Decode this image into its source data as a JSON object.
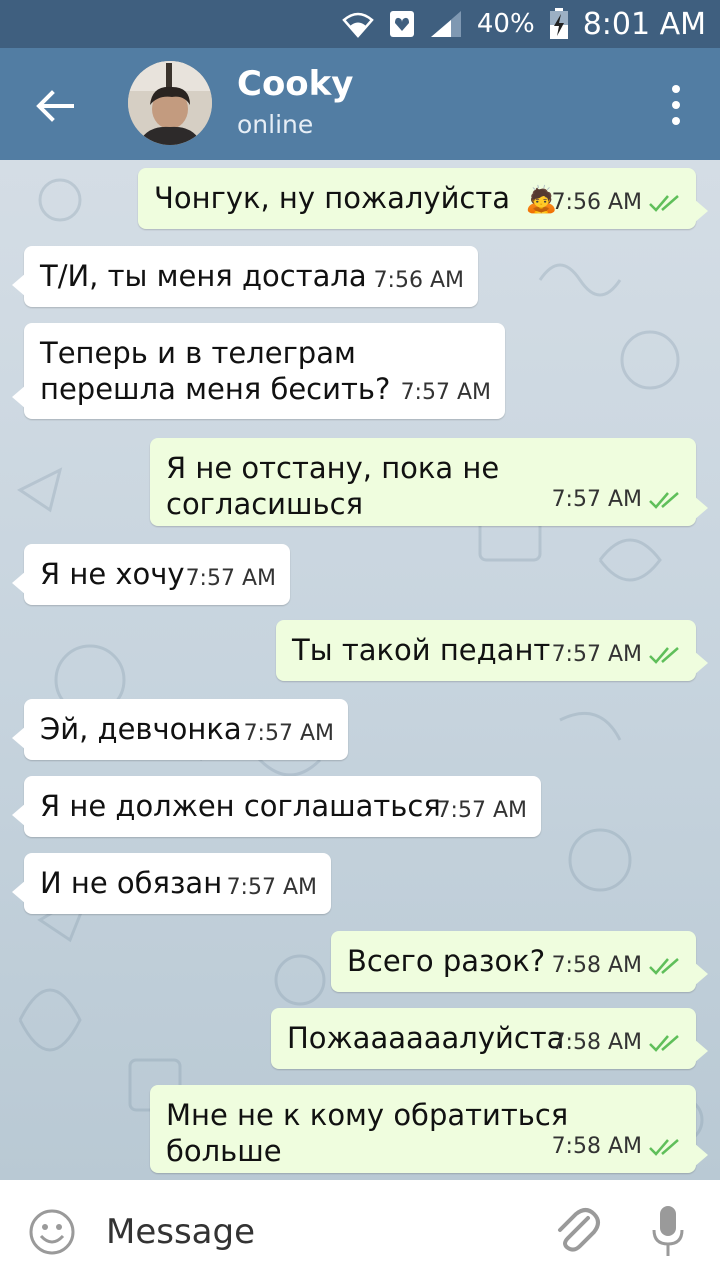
{
  "status": {
    "battery": "40%",
    "time": "8:01 AM"
  },
  "header": {
    "title": "Cooky",
    "subtitle": "online"
  },
  "messages": [
    {
      "dir": "out",
      "text": "Чонгук, ну пожалуйста",
      "emoji": "🙇",
      "time": "7:56 AM",
      "read": true
    },
    {
      "dir": "in",
      "text": "Т/И, ты меня достала",
      "time": "7:56 AM"
    },
    {
      "dir": "in",
      "text": "Теперь и в телеграм перешла меня бесить?",
      "time": "7:57 AM"
    },
    {
      "dir": "out",
      "text": "Я не отстану, пока не согласишься",
      "time": "7:57 AM",
      "read": true
    },
    {
      "dir": "in",
      "text": "Я не хочу",
      "time": "7:57 AM"
    },
    {
      "dir": "out",
      "text": "Ты такой педант",
      "time": "7:57 AM",
      "read": true
    },
    {
      "dir": "in",
      "text": "Эй, девчонка",
      "time": "7:57 AM"
    },
    {
      "dir": "in",
      "text": "Я не должен соглашаться",
      "time": "7:57 AM"
    },
    {
      "dir": "in",
      "text": "И не обязан",
      "time": "7:57 AM"
    },
    {
      "dir": "out",
      "text": "Всего разок?",
      "time": "7:58 AM",
      "read": true
    },
    {
      "dir": "out",
      "text": "Пожаааааалуйста",
      "time": "7:58 AM",
      "read": true
    },
    {
      "dir": "out",
      "text": "Мне не к кому обратиться больше",
      "time": "7:58 AM",
      "read": true
    }
  ],
  "composer": {
    "placeholder": "Message"
  },
  "colors": {
    "header": "#527da3",
    "statusbar": "#3f5f7f",
    "outgoing_bubble": "#effdde",
    "incoming_bubble": "#ffffff",
    "read_check": "#5fbf5a"
  }
}
